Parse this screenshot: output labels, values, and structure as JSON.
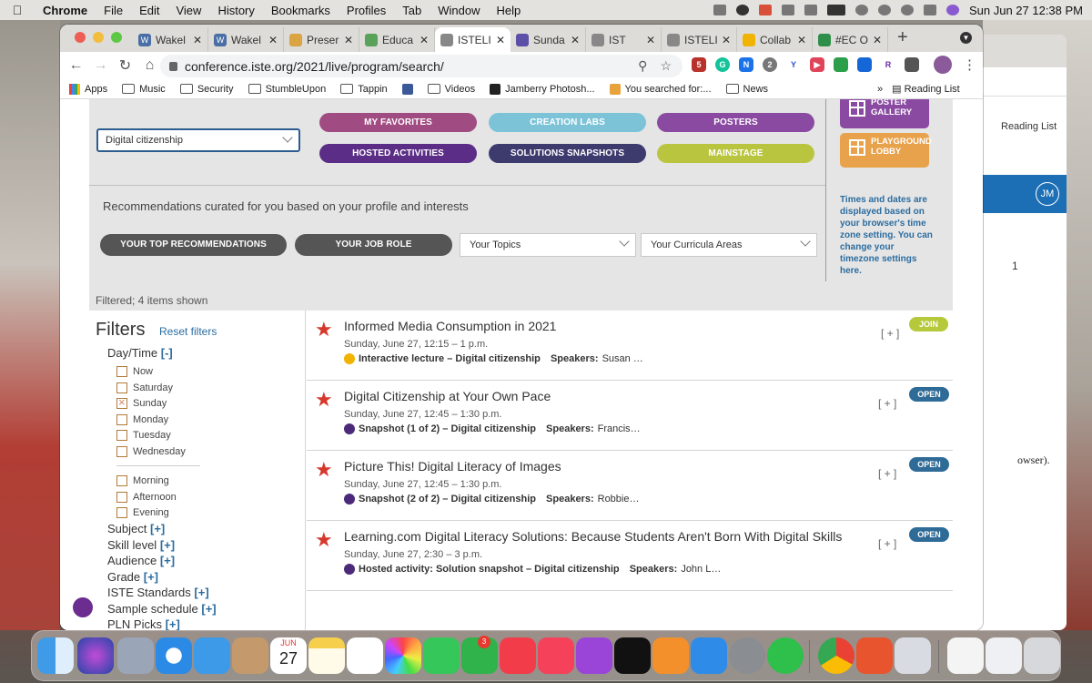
{
  "menubar": {
    "app": "Chrome",
    "items": [
      "File",
      "Edit",
      "View",
      "History",
      "Bookmarks",
      "Profiles",
      "Tab",
      "Window",
      "Help"
    ],
    "clock": "Sun Jun 27  12:38 PM"
  },
  "tabs": [
    {
      "label": "Wakel",
      "color": "#4a6fa5",
      "glyph": "W"
    },
    {
      "label": "Wakel",
      "color": "#4a6fa5",
      "glyph": "W"
    },
    {
      "label": "Preser",
      "color": "#d9a441",
      "glyph": ""
    },
    {
      "label": "Educa",
      "color": "#5aa15a",
      "glyph": ""
    },
    {
      "label": "ISTELI",
      "color": "#888",
      "glyph": "",
      "active": true
    },
    {
      "label": "Sunda",
      "color": "#5b4fa8",
      "glyph": ""
    },
    {
      "label": "IST",
      "color": "#888",
      "glyph": ""
    },
    {
      "label": "ISTELI",
      "color": "#888",
      "glyph": ""
    },
    {
      "label": "Collab",
      "color": "#f0b400",
      "glyph": ""
    },
    {
      "label": "#EC O",
      "color": "#2f8f4a",
      "glyph": ""
    }
  ],
  "url": "conference.iste.org/2021/live/program/search/",
  "bookmarks": [
    "Apps",
    "Music",
    "Security",
    "StumbleUpon",
    "Tappin",
    "",
    "Videos",
    "Jamberry Photosh...",
    "You searched for:...",
    "News"
  ],
  "reading_list": "Reading List",
  "page": {
    "topic_select": "Digital citizenship",
    "pills": {
      "my_favorites": "MY FAVORITES",
      "creation_labs": "CREATION LABS",
      "posters": "POSTERS",
      "hosted_activities": "HOSTED ACTIVITIES",
      "solutions_snapshots": "SOLUTIONS SNAPSHOTS",
      "mainstage": "MAINSTAGE"
    },
    "side": {
      "poster_gallery": "POSTER GALLERY",
      "playground_lobby": "PLAYGROUND LOBBY",
      "tz_note": "Times and dates are displayed based on your browser's time zone setting. You can change your timezone settings here."
    },
    "rec_title": "Recommendations curated for you based on your profile and interests",
    "rec_buttons": {
      "top": "YOUR TOP RECOMMENDATIONS",
      "job": "YOUR JOB ROLE"
    },
    "dropdowns": {
      "topics": "Your Topics",
      "curricula": "Your Curricula Areas"
    },
    "filtered": "Filtered; 4 items shown",
    "filters": {
      "heading": "Filters",
      "reset": "Reset filters",
      "daytime": "Day/Time",
      "daytime_toggle": "[-]",
      "days": [
        "Now",
        "Saturday",
        "Sunday",
        "Monday",
        "Tuesday",
        "Wednesday"
      ],
      "times": [
        "Morning",
        "Afternoon",
        "Evening"
      ],
      "sections": [
        "Subject",
        "Skill level",
        "Audience",
        "Grade",
        "ISTE Standards",
        "Sample schedule",
        "PLN Picks"
      ],
      "expand": "[+]"
    },
    "sessions": [
      {
        "title": "Informed Media Consumption in 2021",
        "date": "Sunday, June 27, 12:15 – 1 p.m.",
        "type": "Interactive lecture – Digital citizenship",
        "speakers_label": "Speakers:",
        "speakers": "Susan …",
        "status": "JOIN",
        "status_color": "#b5c93a",
        "icon_color": "#f0b400"
      },
      {
        "title": "Digital Citizenship at Your Own Pace",
        "date": "Sunday, June 27, 12:45 – 1:30 p.m.",
        "type": "Snapshot (1 of 2) – Digital citizenship",
        "speakers_label": "Speakers:",
        "speakers": "Francis…",
        "status": "OPEN",
        "status_color": "#2f6b97",
        "icon_color": "#4b2a7a"
      },
      {
        "title": "Picture This! Digital Literacy of Images",
        "date": "Sunday, June 27, 12:45 – 1:30 p.m.",
        "type": "Snapshot (2 of 2) – Digital citizenship",
        "speakers_label": "Speakers:",
        "speakers": "Robbie…",
        "status": "OPEN",
        "status_color": "#2f6b97",
        "icon_color": "#4b2a7a"
      },
      {
        "title": "Learning.com Digital Literacy Solutions: Because Students Aren't Born With Digital Skills",
        "date": "Sunday, June 27, 2:30 – 3 p.m.",
        "type": "Hosted activity: Solution snapshot – Digital citizenship",
        "speakers_label": "Speakers:",
        "speakers": "John L…",
        "status": "OPEN",
        "status_color": "#2f6b97",
        "icon_color": "#4b2a7a"
      }
    ],
    "plus": "[ + ]"
  },
  "second_window": {
    "reading_list": "Reading List",
    "avatar": "JM",
    "count": "1",
    "partial_text": "owser)."
  },
  "dock": {
    "calendar_month": "JUN",
    "calendar_day": "27",
    "facetime_badge": "3"
  }
}
